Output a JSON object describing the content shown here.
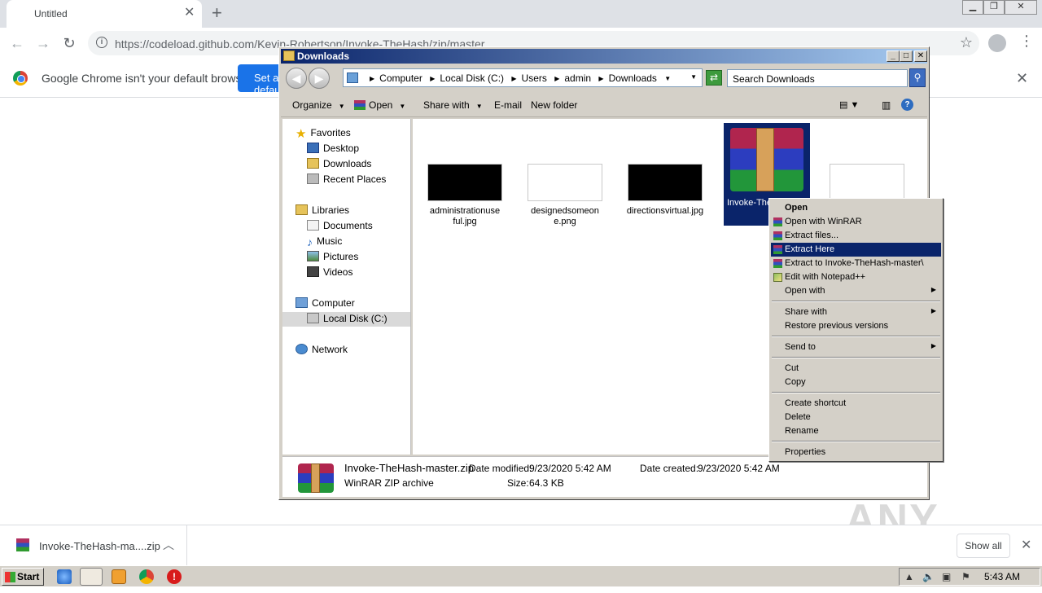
{
  "chrome": {
    "tab_title": "Untitled",
    "url": "https://codeload.github.com/Kevin-Robertson/Invoke-TheHash/zip/master",
    "infobar_text": "Google Chrome isn't your default browser",
    "infobar_button": "Set as default",
    "download_name": "Invoke-TheHash-ma....zip",
    "show_all": "Show all"
  },
  "explorer": {
    "title": "Downloads",
    "breadcrumb": [
      "Computer",
      "Local Disk (C:)",
      "Users",
      "admin",
      "Downloads"
    ],
    "search_placeholder": "Search Downloads",
    "commands": {
      "organize": "Organize",
      "open": "Open",
      "share": "Share with",
      "email": "E-mail",
      "new_folder": "New folder"
    },
    "nav": {
      "favorites": "Favorites",
      "desktop": "Desktop",
      "downloads": "Downloads",
      "recent": "Recent Places",
      "libraries": "Libraries",
      "documents": "Documents",
      "music": "Music",
      "pictures": "Pictures",
      "videos": "Videos",
      "computer": "Computer",
      "local_disk": "Local Disk (C:)",
      "network": "Network"
    },
    "files": [
      {
        "name": "administrationuseful.jpg"
      },
      {
        "name": "designedsomeone.png"
      },
      {
        "name": "directionsvirtual.jpg"
      },
      {
        "name": "Invoke-TheHash-master.zip"
      }
    ],
    "details": {
      "filename": "Invoke-TheHash-master.zip",
      "type": "WinRAR ZIP archive",
      "modified_label": "Date modified:",
      "modified": "9/23/2020 5:42 AM",
      "created_label": "Date created:",
      "created": "9/23/2020 5:42 AM",
      "size_label": "Size:",
      "size": "64.3 KB"
    }
  },
  "context_menu": {
    "open": "Open",
    "open_winrar": "Open with WinRAR",
    "extract_files": "Extract files...",
    "extract_here": "Extract Here",
    "extract_to": "Extract to Invoke-TheHash-master\\",
    "edit_notepad": "Edit with Notepad++",
    "open_with": "Open with",
    "share_with": "Share with",
    "restore": "Restore previous versions",
    "send_to": "Send to",
    "cut": "Cut",
    "copy": "Copy",
    "create_shortcut": "Create shortcut",
    "delete": "Delete",
    "rename": "Rename",
    "properties": "Properties"
  },
  "taskbar": {
    "start": "Start",
    "clock": "5:43 AM"
  },
  "watermark": "ANY RUN"
}
